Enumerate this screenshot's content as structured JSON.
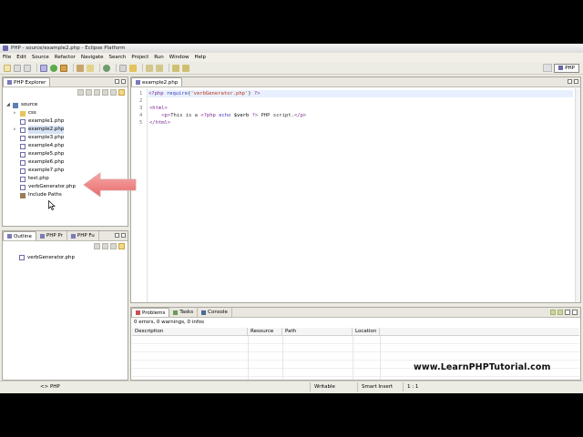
{
  "window": {
    "title": "PHP - source/example2.php - Eclipse Platform"
  },
  "menu": [
    "File",
    "Edit",
    "Source",
    "Refactor",
    "Navigate",
    "Search",
    "Project",
    "Run",
    "Window",
    "Help"
  ],
  "perspective": {
    "label": "PHP"
  },
  "explorer": {
    "tab_label": "PHP Explorer",
    "tree": [
      {
        "label": "source",
        "level": 0,
        "icon": "project-icon"
      },
      {
        "label": "css",
        "level": 1,
        "icon": "folder-icon"
      },
      {
        "label": "example1.php",
        "level": 1,
        "icon": "php-file-icon"
      },
      {
        "label": "example2.php",
        "level": 1,
        "icon": "php-file-icon",
        "selected": true
      },
      {
        "label": "example3.php",
        "level": 1,
        "icon": "php-file-icon"
      },
      {
        "label": "example4.php",
        "level": 1,
        "icon": "php-file-icon"
      },
      {
        "label": "example5.php",
        "level": 1,
        "icon": "php-file-icon"
      },
      {
        "label": "example6.php",
        "level": 1,
        "icon": "php-file-icon"
      },
      {
        "label": "example7.php",
        "level": 1,
        "icon": "php-file-icon"
      },
      {
        "label": "test.php",
        "level": 1,
        "icon": "php-file-icon"
      },
      {
        "label": "verbGenerator.php",
        "level": 1,
        "icon": "php-file-icon"
      },
      {
        "label": "Include Paths",
        "level": 1,
        "icon": "library-icon"
      }
    ]
  },
  "outline": {
    "tabs": [
      "Outline",
      "PHP Pr",
      "PHP Fu"
    ],
    "item": "verbGenerator.php"
  },
  "editor": {
    "tab_label": "example2.php",
    "lines": [
      {
        "num": "1",
        "html": "<span class=\"c-tag\">&lt;?php</span> <span class=\"c-kw\">require</span>(<span class=\"c-str\">'verbGenerator.php'</span>) <span class=\"c-tag\">?&gt;</span>"
      },
      {
        "num": "2",
        "html": ""
      },
      {
        "num": "3",
        "html": "<span class=\"c-tag\">&lt;html&gt;</span>"
      },
      {
        "num": "4",
        "html": "    <span class=\"c-tag\">&lt;p&gt;</span><span class=\"c-plain\">This is a </span><span class=\"c-tag\">&lt;?php</span> <span class=\"c-kw\">echo</span> $verb <span class=\"c-tag\">?&gt;</span><span class=\"c-plain\"> PHP script.</span><span class=\"c-tag\">&lt;/p&gt;</span>"
      },
      {
        "num": "5",
        "html": "<span class=\"c-tag\">&lt;/html&gt;</span>"
      }
    ]
  },
  "problems": {
    "tabs": [
      "Problems",
      "Tasks",
      "Console"
    ],
    "summary": "0 errors, 0 warnings, 0 infos",
    "columns": [
      "Description",
      "Resource",
      "Path",
      "Location"
    ]
  },
  "status": {
    "breadcrumb": "<> PHP",
    "writable": "Writable",
    "insert_mode": "Smart Insert",
    "position": "1 : 1"
  },
  "watermark": "www.LearnPHPTutorial.com",
  "colors": {
    "arrow": "#f08080",
    "tag": "#7b2a8e",
    "keyword": "#3d3db8",
    "string": "#c0320f"
  }
}
